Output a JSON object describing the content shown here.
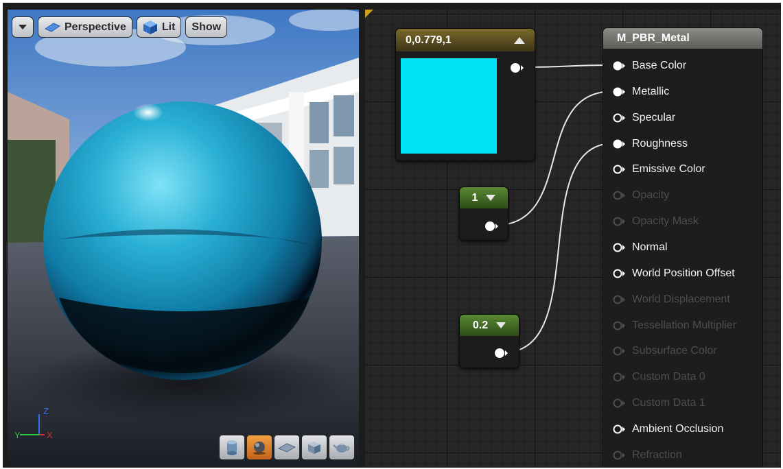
{
  "viewport": {
    "toolbar": {
      "menu_icon": "chevron-down-icon",
      "perspective_label": "Perspective",
      "perspective_icon": "perspective-plane-icon",
      "lit_label": "Lit",
      "lit_icon": "lit-cube-icon",
      "show_label": "Show"
    },
    "axis": {
      "z": "Z",
      "y": "Y",
      "x": "X"
    },
    "preview_modes": [
      {
        "icon": "cylinder-icon",
        "active": false
      },
      {
        "icon": "sphere-icon",
        "active": true
      },
      {
        "icon": "plane-icon",
        "active": false
      },
      {
        "icon": "cube-icon",
        "active": false
      },
      {
        "icon": "teapot-icon",
        "active": false
      }
    ]
  },
  "graph": {
    "vector_node": {
      "title": "0,0.779,1",
      "collapse_icon": "triangle-up-icon",
      "color": "#00e3f7"
    },
    "constant_nodes": [
      {
        "value": "1",
        "icon": "triangle-down-icon"
      },
      {
        "value": "0.2",
        "icon": "triangle-down-icon"
      }
    ],
    "material_node": {
      "title": "M_PBR_Metal",
      "inputs": [
        {
          "label": "Base Color",
          "connected": true,
          "enabled": true
        },
        {
          "label": "Metallic",
          "connected": true,
          "enabled": true
        },
        {
          "label": "Specular",
          "connected": false,
          "enabled": true
        },
        {
          "label": "Roughness",
          "connected": true,
          "enabled": true
        },
        {
          "label": "Emissive Color",
          "connected": false,
          "enabled": true
        },
        {
          "label": "Opacity",
          "connected": false,
          "enabled": false
        },
        {
          "label": "Opacity Mask",
          "connected": false,
          "enabled": false
        },
        {
          "label": "Normal",
          "connected": false,
          "enabled": true
        },
        {
          "label": "World Position Offset",
          "connected": false,
          "enabled": true
        },
        {
          "label": "World Displacement",
          "connected": false,
          "enabled": false
        },
        {
          "label": "Tessellation Multiplier",
          "connected": false,
          "enabled": false
        },
        {
          "label": "Subsurface Color",
          "connected": false,
          "enabled": false
        },
        {
          "label": "Custom Data 0",
          "connected": false,
          "enabled": false
        },
        {
          "label": "Custom Data 1",
          "connected": false,
          "enabled": false
        },
        {
          "label": "Ambient Occlusion",
          "connected": false,
          "enabled": true
        },
        {
          "label": "Refraction",
          "connected": false,
          "enabled": false
        }
      ]
    }
  }
}
